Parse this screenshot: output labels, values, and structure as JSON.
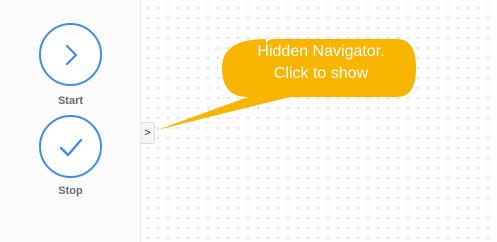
{
  "palette": {
    "nodes": [
      {
        "label": "Start",
        "icon": "chevron-right-icon"
      },
      {
        "label": "Stop",
        "icon": "checkmark-icon"
      }
    ]
  },
  "navigator_toggle": {
    "label": ">"
  },
  "callout": {
    "line1": "Hidden Navigator.",
    "line2": "Click to show"
  },
  "colors": {
    "accent": "#3c8fe8",
    "callout": "#f7b500",
    "label": "#6a6a70"
  }
}
